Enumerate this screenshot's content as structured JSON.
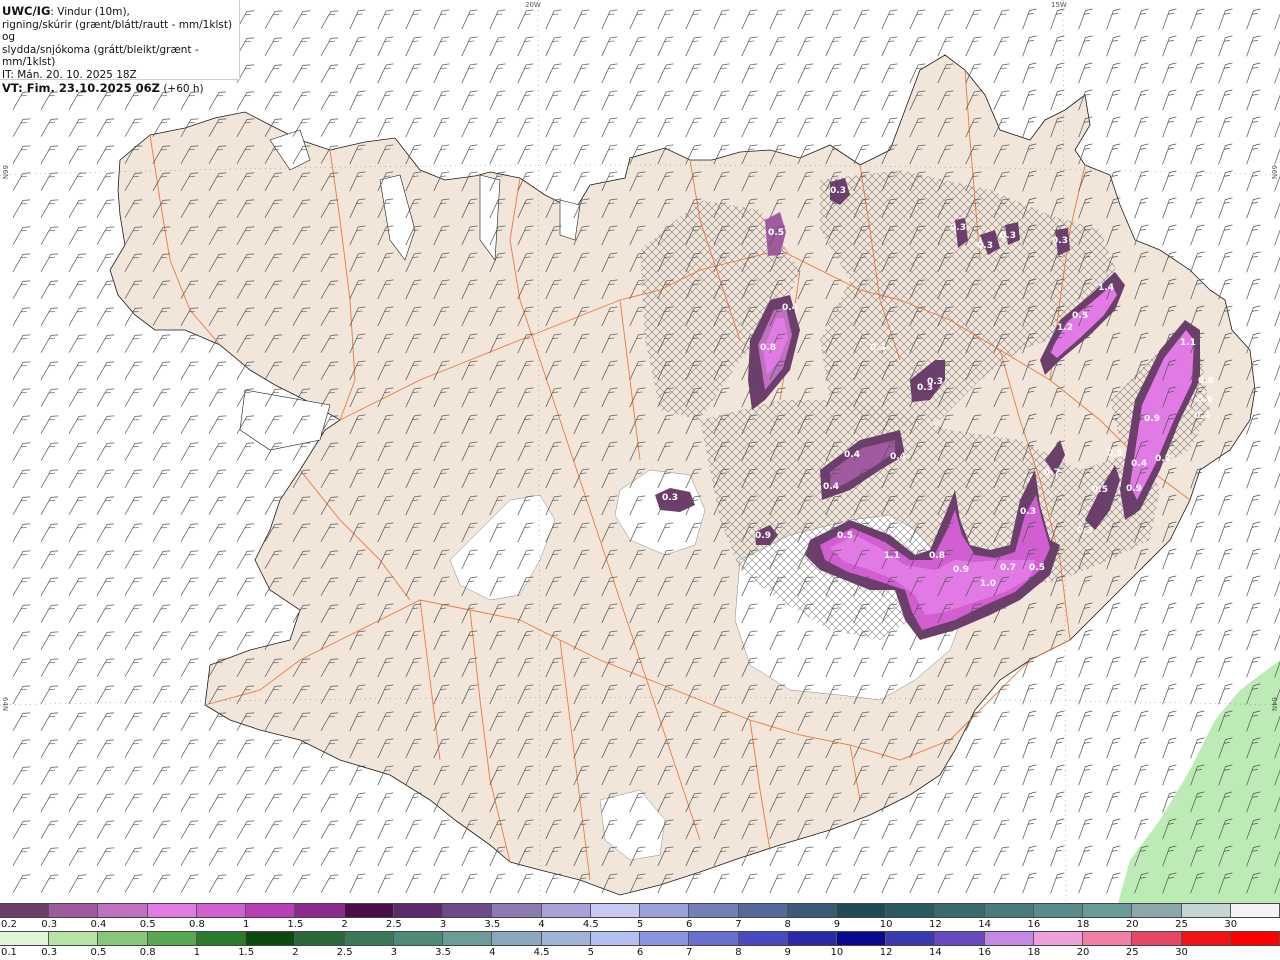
{
  "title": {
    "model": "UWC/IG",
    "line1": ": Vindur (10m),",
    "line2": "rigning/skúrir (grænt/blátt/rautt - mm/1klst) og",
    "line3": "slydda/snjókoma (grátt/bleikt/grænt - mm/1klst)",
    "it": "IT: Mán. 20. 10. 2025 18Z",
    "vt": "VT: Fim. 23.10.2025 06Z",
    "lead": "(+60 h)"
  },
  "grid_labels": {
    "top_left": "20W",
    "top_right": "15W",
    "left_upper": "66N",
    "right_upper": "66N",
    "left_lower": "64N",
    "right_lower": "64N"
  },
  "precip_labels": [
    "0.5",
    "0.3",
    "0.3",
    "0.3",
    "0.3",
    "0.3",
    "0.4",
    "0.8",
    "1.4",
    "0.3",
    "1.2",
    "1.1",
    "0.3",
    "0.3",
    "0.5",
    "0.6",
    "0.6",
    "0.9",
    "0.4",
    "0.4",
    "0.4",
    "0.4",
    "0.5",
    "0.4",
    "0.3",
    "0.7",
    "0.5",
    "0.3",
    "0.9",
    "0.3",
    "0.3",
    "0.9",
    "0.5",
    "1.1",
    "0.8",
    "0.9",
    "1.0",
    "0.7",
    "0.5"
  ],
  "colorbar_snow": {
    "labels": [
      "0.2",
      "0.3",
      "0.4",
      "0.5",
      "0.8",
      "1",
      "1.5",
      "2",
      "2.5",
      "3",
      "3.5",
      "4",
      "4.5",
      "5",
      "6",
      "7",
      "8",
      "9",
      "10",
      "12",
      "14",
      "16",
      "18",
      "20",
      "25",
      "30"
    ],
    "colors": [
      "#6b3e6b",
      "#a05aa0",
      "#c070c0",
      "#e27ae6",
      "#d25fd2",
      "#b83fb8",
      "#8e2a8e",
      "#4a0c4a",
      "#5c2a6a",
      "#6e4a8a",
      "#8a7ab0",
      "#a7a2d8",
      "#c8c8f0",
      "#9aa0d8",
      "#7380b8",
      "#536a9a",
      "#3a5a78",
      "#1f4a58",
      "#2a5a60",
      "#3a6a6e",
      "#4a7a7c",
      "#5a8a8a",
      "#6a9a98",
      "#8aa8a8",
      "#c6d4d4",
      "#f4f4f4"
    ]
  },
  "colorbar_rain": {
    "labels": [
      "0.1",
      "0.3",
      "0.5",
      "0.8",
      "1",
      "1.5",
      "2",
      "2.5",
      "3",
      "3.5",
      "4",
      "4.5",
      "5",
      "6",
      "7",
      "8",
      "9",
      "10",
      "12",
      "14",
      "16",
      "18",
      "20",
      "25",
      "30"
    ],
    "colors": [
      "#dff5d8",
      "#b6e4a8",
      "#86c878",
      "#58a850",
      "#2c7a2c",
      "#0c4a10",
      "#2a6a3a",
      "#3a7a58",
      "#4e8a78",
      "#6e9a98",
      "#8aa8c0",
      "#a0b4d8",
      "#b4c0f0",
      "#8a94e0",
      "#6a70d0",
      "#4a4ac0",
      "#2a2aa8",
      "#0a0a90",
      "#3a3ab0",
      "#6a4ac0",
      "#c488e8",
      "#f0a0d8",
      "#f080a8",
      "#e84868",
      "#f01414",
      "#ff0000"
    ]
  },
  "colors": {
    "land": "#f2e6da",
    "roads": "#e8743a",
    "sea": "#ffffff",
    "snow_precip": "#d45fd6",
    "rain_precip": "#9be596"
  },
  "icons": [
    "wind-barb-icon"
  ]
}
